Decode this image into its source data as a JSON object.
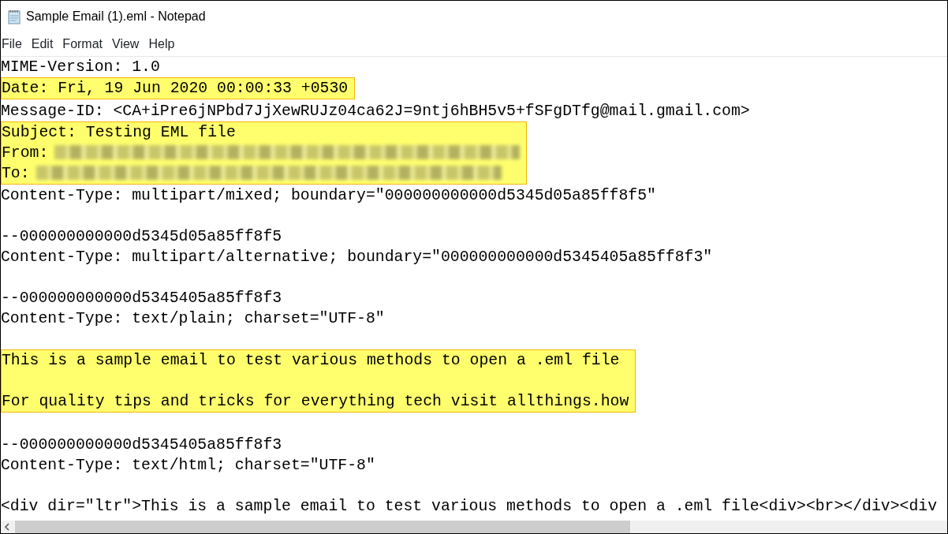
{
  "window": {
    "title": "Sample Email (1).eml - Notepad"
  },
  "menu": [
    "File",
    "Edit",
    "Format",
    "View",
    "Help"
  ],
  "blocks": [
    {
      "highlighted": false,
      "lines": [
        {
          "text": "MIME-Version: 1.0"
        }
      ]
    },
    {
      "highlighted": true,
      "lines": [
        {
          "text": "Date: Fri, 19 Jun 2020 00:00:33 +0530"
        }
      ]
    },
    {
      "highlighted": false,
      "lines": [
        {
          "text": "Message-ID: <CA+iPre6jNPbd7JjXewRUJz04ca62J=9ntj6hBH5v5+fSFgDTfg@mail.gmail.com>"
        }
      ]
    },
    {
      "highlighted": true,
      "lines": [
        {
          "text": "Subject: Testing EML file"
        },
        {
          "text": "From:",
          "redacted": true
        },
        {
          "text": "To:",
          "redacted": true
        }
      ]
    },
    {
      "highlighted": false,
      "lines": [
        {
          "text": "Content-Type: multipart/mixed; boundary=\"000000000000d5345d05a85ff8f5\""
        },
        {
          "text": "--000000000000d5345d05a85ff8f5",
          "space_before": true
        },
        {
          "text": "Content-Type: multipart/alternative; boundary=\"000000000000d5345405a85ff8f3\""
        },
        {
          "text": "--000000000000d5345405a85ff8f3",
          "space_before": true
        },
        {
          "text": "Content-Type: text/plain; charset=\"UTF-8\""
        }
      ]
    },
    {
      "highlighted": true,
      "space_before": true,
      "lines": [
        {
          "text": "This is a sample email to test various methods to open a .eml file"
        },
        {
          "text": "For quality tips and tricks for everything tech visit allthings.how",
          "space_before": true
        }
      ]
    },
    {
      "highlighted": false,
      "space_before": true,
      "lines": [
        {
          "text": "--000000000000d5345405a85ff8f3"
        },
        {
          "text": "Content-Type: text/html; charset=\"UTF-8\""
        },
        {
          "text": "<div dir=\"ltr\">This is a sample email to test various methods to open a .eml file<div><br></div><div",
          "space_before": true
        }
      ]
    }
  ]
}
